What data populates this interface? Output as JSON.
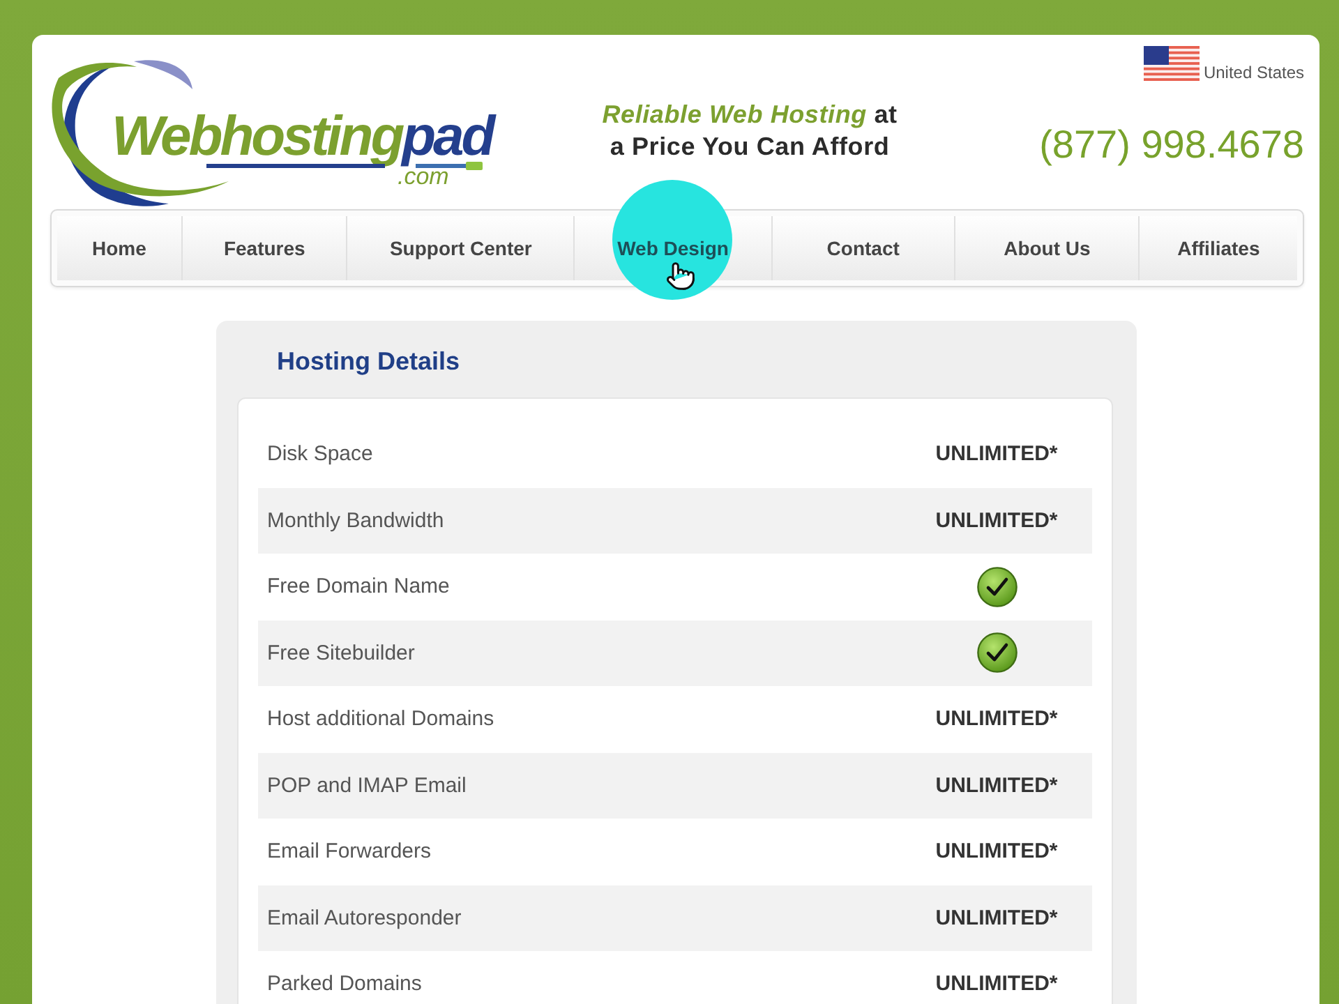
{
  "header": {
    "logo": {
      "wordmark": [
        "Webhosting",
        "pad"
      ],
      "domain": ".com"
    },
    "tagline": "*Reliable Web Hosting* at a Price You Can Afford",
    "region": "United States",
    "phone": "(877) 998.4678"
  },
  "nav": {
    "items": [
      {
        "label": "Home",
        "clicked": false
      },
      {
        "label": "Features",
        "clicked": false
      },
      {
        "label": "Support Center",
        "clicked": false
      },
      {
        "label": "Web Design",
        "clicked": true
      },
      {
        "label": "Contact",
        "clicked": false
      },
      {
        "label": "About Us",
        "clicked": false
      },
      {
        "label": "Affiliates",
        "clicked": false
      }
    ]
  },
  "hosting_details": {
    "title": "Hosting Details",
    "rows": [
      {
        "label": "Disk Space",
        "kind": "text",
        "value": "UNLIMITED*"
      },
      {
        "label": "Monthly Bandwidth",
        "kind": "text",
        "value": "UNLIMITED*"
      },
      {
        "label": "Free Domain Name",
        "kind": "check"
      },
      {
        "label": "Free Sitebuilder",
        "kind": "check"
      },
      {
        "label": "Host additional Domains",
        "kind": "text",
        "value": "UNLIMITED*"
      },
      {
        "label": "POP and IMAP Email",
        "kind": "text",
        "value": "UNLIMITED*"
      },
      {
        "label": "Email Forwarders",
        "kind": "text",
        "value": "UNLIMITED*"
      },
      {
        "label": "Email Autoresponder",
        "kind": "text",
        "value": "UNLIMITED*"
      },
      {
        "label": "Parked Domains",
        "kind": "text",
        "value": "UNLIMITED*"
      }
    ]
  }
}
